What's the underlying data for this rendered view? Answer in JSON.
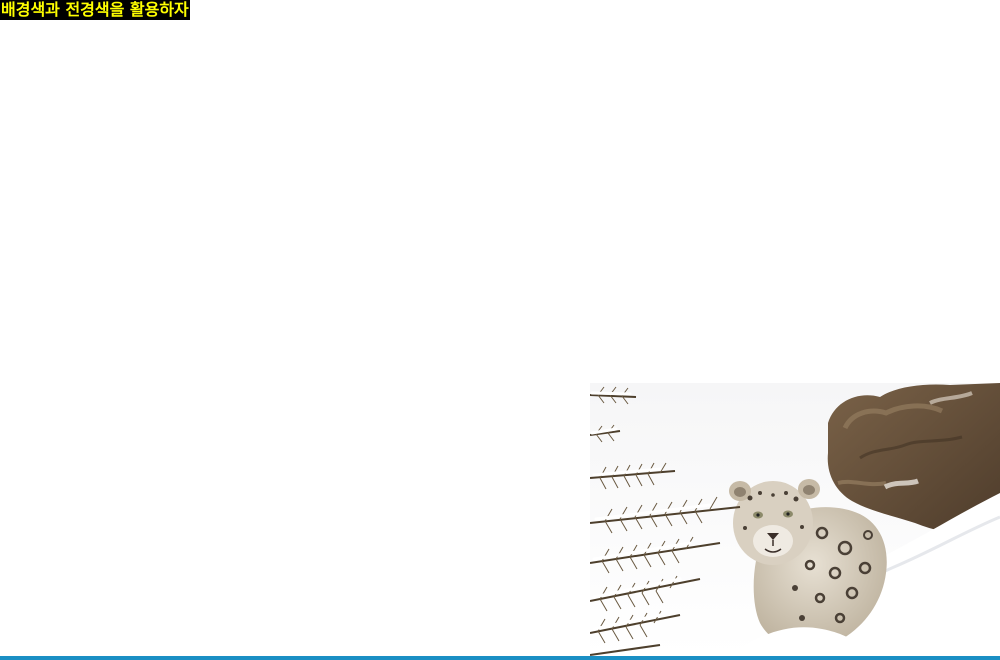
{
  "heading": {
    "text": "배경색과 전경색을 활용하자",
    "text_color": "#ffff00",
    "background_color": "#000000"
  },
  "photo": {
    "subject": "snow-leopard-in-snow"
  },
  "bottom_bar": {
    "color": "#1a8fc4"
  }
}
